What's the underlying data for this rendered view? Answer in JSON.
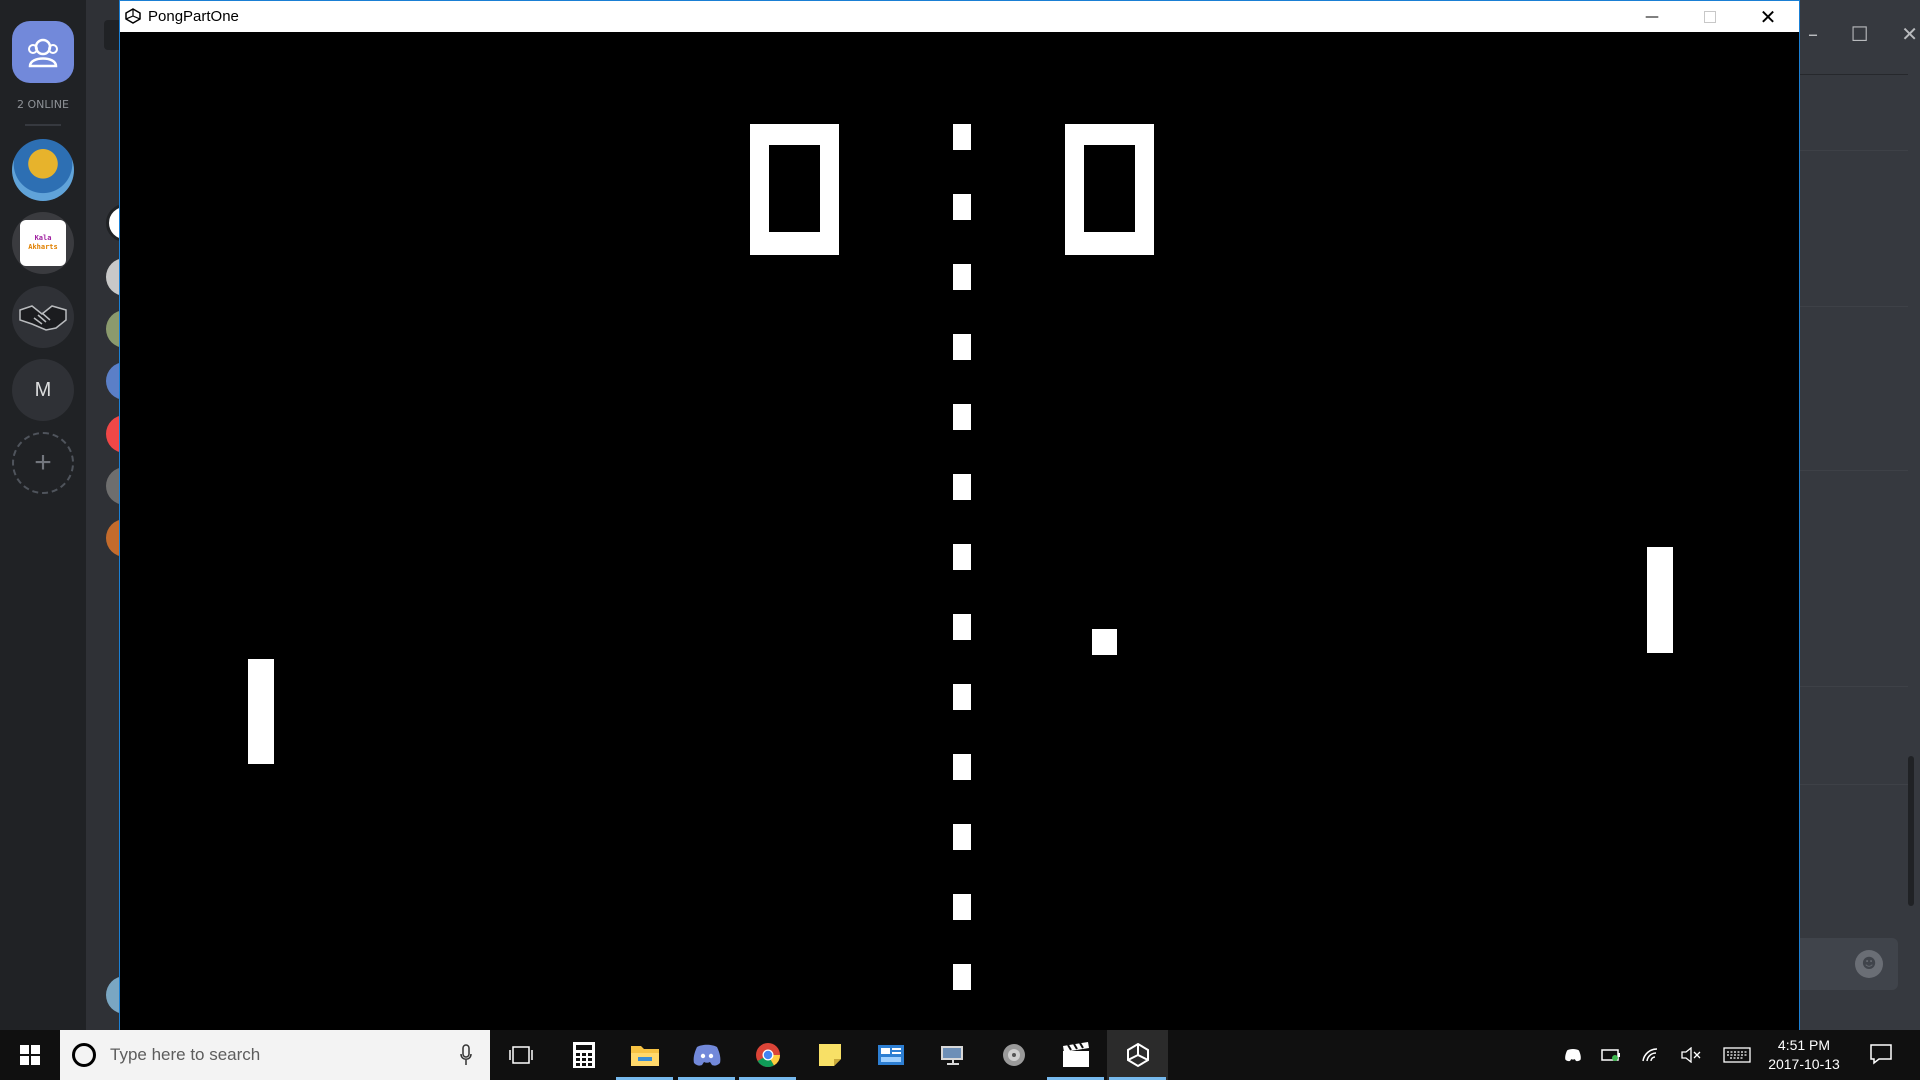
{
  "discord": {
    "online_count": "2 ONLINE",
    "servers": [
      {
        "name": "avatar-server",
        "icon": "buddha-avatar"
      },
      {
        "name": "kala-akharts",
        "text_line1": "Kala",
        "text_line2": "Akharts"
      },
      {
        "name": "handshake-server",
        "icon": "handshake-icon"
      },
      {
        "name": "m-server",
        "letter": "M"
      }
    ],
    "add_server_glyph": "+"
  },
  "game_window": {
    "title": "PongPartOne",
    "minimize_glyph": "—",
    "close_glyph": "✕"
  },
  "pong": {
    "score_left": 0,
    "score_right": 0,
    "net_segments": 13
  },
  "taskbar": {
    "search_placeholder": "Type here to search",
    "pinned_apps": [
      {
        "name": "task-view",
        "active": false
      },
      {
        "name": "calculator",
        "active": false
      },
      {
        "name": "file-explorer",
        "active": true
      },
      {
        "name": "discord",
        "active": true
      },
      {
        "name": "chrome",
        "active": true
      },
      {
        "name": "sticky-notes",
        "active": false
      },
      {
        "name": "control-panel",
        "active": false
      },
      {
        "name": "remote-desktop",
        "active": false
      },
      {
        "name": "media-player",
        "active": false
      },
      {
        "name": "movie-maker",
        "active": true
      },
      {
        "name": "unity",
        "active": true,
        "current": true
      }
    ],
    "clock_time": "4:51 PM",
    "clock_date": "2017-10-13"
  },
  "colors": {
    "discord_blurple": "#7289da",
    "rail_bg": "#202225",
    "game_bg": "#000000",
    "taskbar_bg": "#101010",
    "active_indicator": "#76b9ed"
  }
}
